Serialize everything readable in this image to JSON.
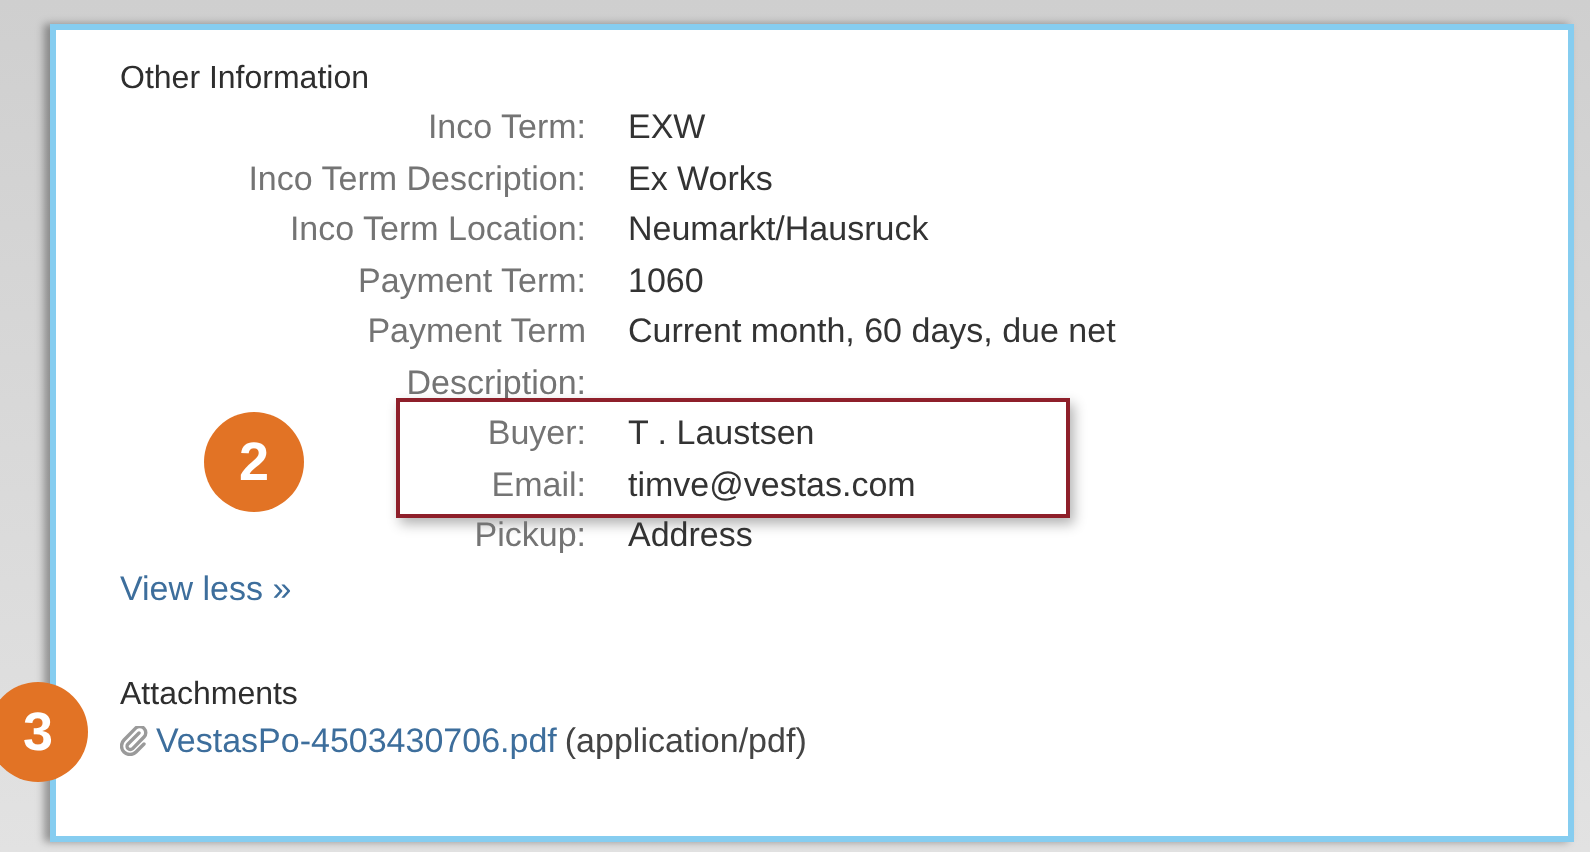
{
  "section": {
    "title": "Other Information"
  },
  "fields": [
    {
      "label": "Inco Term:",
      "value": "EXW",
      "highlighted": false
    },
    {
      "label": "Inco Term Description:",
      "value": "Ex Works",
      "highlighted": false
    },
    {
      "label": "Inco Term Location:",
      "value": "Neumarkt/Hausruck",
      "highlighted": false
    },
    {
      "label": "Payment Term:",
      "value": "1060",
      "highlighted": false
    },
    {
      "label": "Payment Term Description:",
      "value": "Current month, 60 days, due net",
      "highlighted": false
    },
    {
      "label": "Buyer:",
      "value": "T . Laustsen",
      "highlighted": true
    },
    {
      "label": "Email:",
      "value": "timve@vestas.com",
      "highlighted": true
    },
    {
      "label": "Pickup:",
      "value": "Address",
      "highlighted": false
    }
  ],
  "view_less_link": "View less »",
  "attachments": {
    "title": "Attachments",
    "file": "VestasPo-4503430706.pdf",
    "type": "(application/pdf)"
  },
  "callouts": [
    {
      "number": "2"
    },
    {
      "number": "3"
    }
  ]
}
